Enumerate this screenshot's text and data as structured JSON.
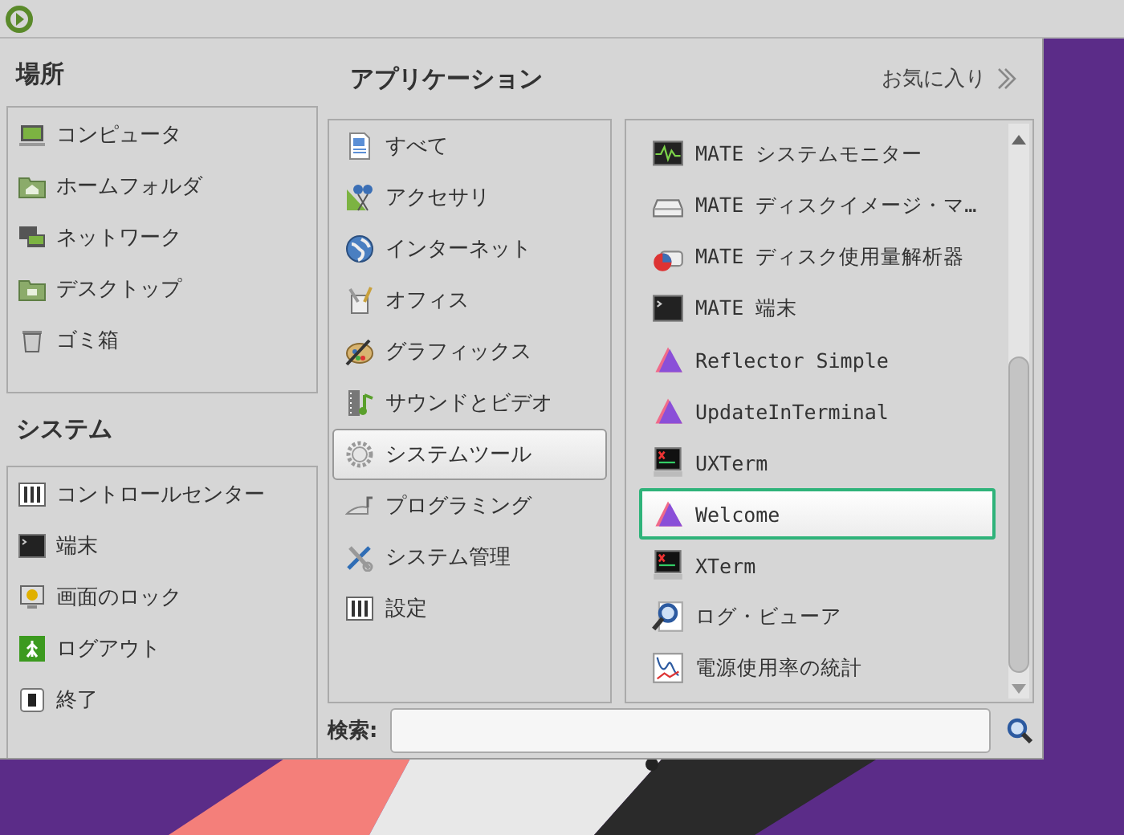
{
  "panel": {
    "menu_button": {
      "kind": "logo"
    }
  },
  "places": {
    "title": "場所",
    "items": [
      {
        "label": "コンピュータ",
        "kind": "computer"
      },
      {
        "label": "ホームフォルダ",
        "kind": "home-folder"
      },
      {
        "label": "ネットワーク",
        "kind": "network"
      },
      {
        "label": "デスクトップ",
        "kind": "desktop-folder"
      },
      {
        "label": "ゴミ箱",
        "kind": "trash"
      }
    ]
  },
  "system": {
    "title": "システム",
    "items": [
      {
        "label": "コントロールセンター",
        "kind": "control-center"
      },
      {
        "label": "端末",
        "kind": "terminal"
      },
      {
        "label": "画面のロック",
        "kind": "lock"
      },
      {
        "label": "ログアウト",
        "kind": "logout"
      },
      {
        "label": "終了",
        "kind": "shutdown"
      }
    ]
  },
  "applications": {
    "title": "アプリケーション",
    "favorites_link": "お気に入り",
    "categories": [
      {
        "label": "すべて",
        "kind": "all",
        "selected": false
      },
      {
        "label": "アクセサリ",
        "kind": "accessories",
        "selected": false
      },
      {
        "label": "インターネット",
        "kind": "internet",
        "selected": false
      },
      {
        "label": "オフィス",
        "kind": "office",
        "selected": false
      },
      {
        "label": "グラフィックス",
        "kind": "graphics",
        "selected": false
      },
      {
        "label": "サウンドとビデオ",
        "kind": "sound-video",
        "selected": false
      },
      {
        "label": "システムツール",
        "kind": "system-tools",
        "selected": true
      },
      {
        "label": "プログラミング",
        "kind": "programming",
        "selected": false
      },
      {
        "label": "システム管理",
        "kind": "admin",
        "selected": false
      },
      {
        "label": "設定",
        "kind": "settings",
        "selected": false
      }
    ],
    "apps": [
      {
        "label": "MATE システムモニター",
        "kind": "monitor",
        "selected": false
      },
      {
        "label": "MATE ディスクイメージ・マ…",
        "kind": "disk-image",
        "selected": false
      },
      {
        "label": "MATE ディスク使用量解析器",
        "kind": "disk-usage",
        "selected": false
      },
      {
        "label": "MATE 端末",
        "kind": "terminal",
        "selected": false
      },
      {
        "label": "Reflector Simple",
        "kind": "triangle",
        "selected": false
      },
      {
        "label": "UpdateInTerminal",
        "kind": "triangle",
        "selected": false
      },
      {
        "label": "UXTerm",
        "kind": "xterm",
        "selected": false
      },
      {
        "label": "Welcome",
        "kind": "triangle",
        "selected": true
      },
      {
        "label": "XTerm",
        "kind": "xterm",
        "selected": false
      },
      {
        "label": "ログ・ビューア",
        "kind": "log-viewer",
        "selected": false
      },
      {
        "label": "電源使用率の統計",
        "kind": "power-stats",
        "selected": false
      }
    ]
  },
  "search": {
    "label": "検索:"
  }
}
